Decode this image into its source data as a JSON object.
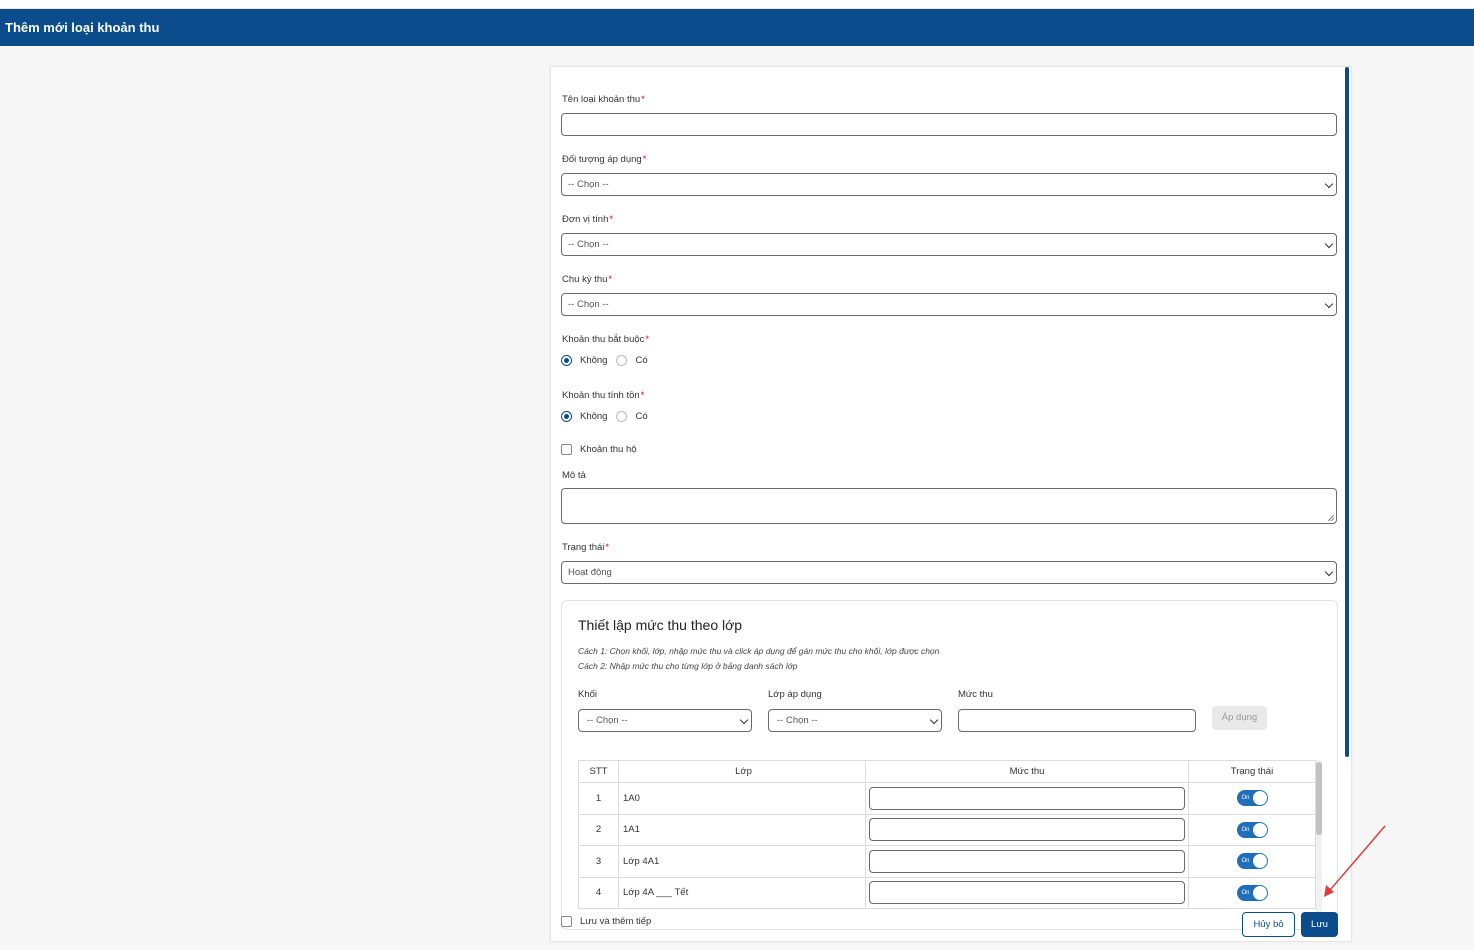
{
  "header": {
    "title": "Thêm mới loại khoản thu"
  },
  "form": {
    "name": {
      "label": "Tên loại khoản thu",
      "required": "*",
      "value": ""
    },
    "target": {
      "label": "Đối tượng áp dụng",
      "required": "*",
      "selected": "-- Chọn --"
    },
    "unit": {
      "label": "Đơn vị tính",
      "required": "*",
      "selected": "-- Chọn --"
    },
    "cycle": {
      "label": "Chu kỳ thu",
      "required": "*",
      "selected": "-- Chọn --"
    },
    "mandatory": {
      "label": "Khoản thu bắt buộc",
      "required": "*",
      "options": [
        "Không",
        "Có"
      ],
      "selected": "Không"
    },
    "carryover": {
      "label": "Khoản thu tính tồn",
      "required": "*",
      "options": [
        "Không",
        "Có"
      ],
      "selected": "Không"
    },
    "collect_on_behalf": {
      "label": "Khoản thu hộ",
      "checked": false
    },
    "description": {
      "label": "Mô tả",
      "value": ""
    },
    "status": {
      "label": "Trạng thái",
      "required": "*",
      "selected": "Hoạt động"
    }
  },
  "class_fees": {
    "title": "Thiết lập mức thu theo lớp",
    "hint1": "Cách 1: Chọn khối, lớp, nhập mức thu và click áp dụng để gán mức thu cho khối, lớp được chọn",
    "hint2": "Cách 2: Nhập mức thu cho từng lớp ở bảng danh sách lớp",
    "grade_label": "Khối",
    "grade_selected": "-- Chọn --",
    "class_label": "Lớp áp dụng",
    "class_selected": "-- Chọn --",
    "fee_label": "Mức thu",
    "apply_label": "Áp dụng",
    "table": {
      "headers": [
        "STT",
        "Lớp",
        "Mức thu",
        "Trạng thái"
      ],
      "toggle_text": "On",
      "rows": [
        {
          "stt": "1",
          "class": "1A0",
          "fee": ""
        },
        {
          "stt": "2",
          "class": "1A1",
          "fee": ""
        },
        {
          "stt": "3",
          "class": "Lớp 4A1",
          "fee": ""
        },
        {
          "stt": "4",
          "class": "Lớp 4A ___ Tết",
          "fee": ""
        }
      ]
    }
  },
  "footer": {
    "save_and_continue": "Lưu và thêm tiếp",
    "cancel_label": "Hủy bỏ",
    "save_label": "Lưu"
  },
  "colors": {
    "primary": "#0b4d8c",
    "required": "#e0001b",
    "annotation_arrow": "#e03c3c"
  }
}
